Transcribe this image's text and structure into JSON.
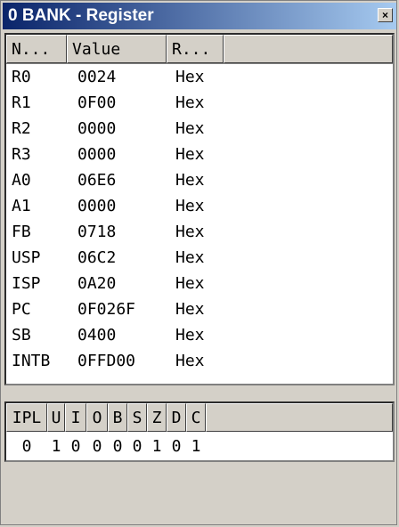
{
  "window": {
    "title": "0 BANK - Register",
    "close_label": "×"
  },
  "register_list": {
    "columns": [
      "N...",
      "Value",
      "R..."
    ],
    "rows": [
      {
        "name": "R0",
        "value": "0024",
        "radix": "Hex"
      },
      {
        "name": "R1",
        "value": "0F00",
        "radix": "Hex"
      },
      {
        "name": "R2",
        "value": "0000",
        "radix": "Hex"
      },
      {
        "name": "R3",
        "value": "0000",
        "radix": "Hex"
      },
      {
        "name": "A0",
        "value": "06E6",
        "radix": "Hex"
      },
      {
        "name": "A1",
        "value": "0000",
        "radix": "Hex"
      },
      {
        "name": "FB",
        "value": "0718",
        "radix": "Hex"
      },
      {
        "name": "USP",
        "value": "06C2",
        "radix": "Hex"
      },
      {
        "name": "ISP",
        "value": "0A20",
        "radix": "Hex"
      },
      {
        "name": "PC",
        "value": "0F026F",
        "radix": "Hex"
      },
      {
        "name": "SB",
        "value": "0400",
        "radix": "Hex"
      },
      {
        "name": "INTB",
        "value": "0FFD00",
        "radix": "Hex"
      }
    ]
  },
  "flags": {
    "headers": [
      "IPL",
      "U",
      "I",
      "O",
      "B",
      "S",
      "Z",
      "D",
      "C"
    ],
    "values": [
      "0",
      "1",
      "0",
      "0",
      "0",
      "0",
      "1",
      "0",
      "1"
    ]
  }
}
